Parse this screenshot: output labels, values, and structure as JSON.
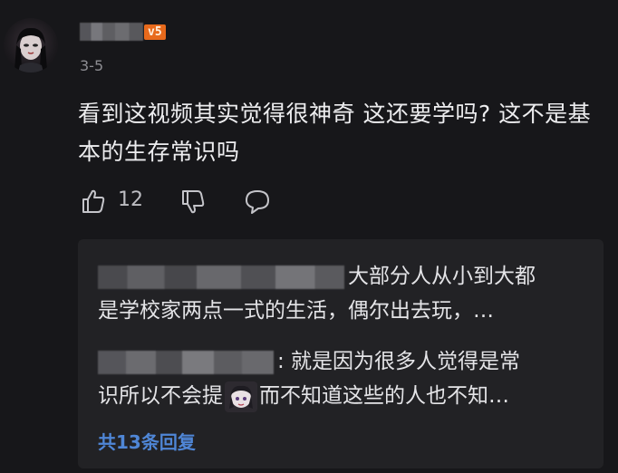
{
  "comment": {
    "level_badge": "v5",
    "date": "3-5",
    "text": "看到这视频其实觉得很神奇 这还要学吗? 这不是基本的生存常识吗",
    "like_count": "12"
  },
  "replies": [
    {
      "line1": "大部分人从小到大都",
      "line2": "是学校家两点一式的生活，偶尔出去玩，…"
    },
    {
      "line1": ": 就是因为很多人觉得是常",
      "line2a": "识所以不会提",
      "line2b": "而不知道这些的人也不知…"
    }
  ],
  "more_replies_label": "共13条回复",
  "icons": [
    "like-icon",
    "dislike-icon",
    "reply-bubble-icon",
    "sticker-emoji-icon"
  ],
  "colors": {
    "background": "#17171a",
    "reply_box": "#222225",
    "badge": "#e86a1c",
    "link": "#4f86d6"
  }
}
